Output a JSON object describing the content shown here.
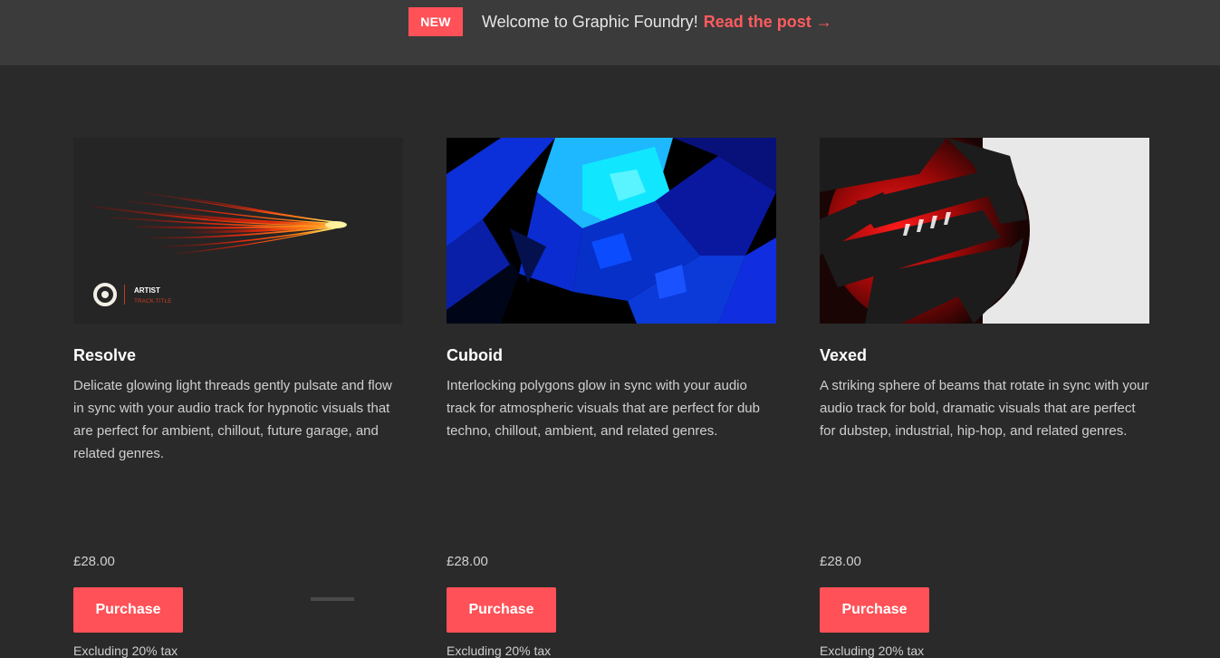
{
  "banner": {
    "badge": "NEW",
    "text": "Welcome to Graphic Foundry!",
    "link": "Read the post →"
  },
  "colors": {
    "accent": "#ff5157",
    "banner_bg": "#3b3b3b",
    "page_bg": "#2a2a2a"
  },
  "products": [
    {
      "title": "Resolve",
      "description": "Delicate glowing light threads gently pulsate and flow in sync with your audio track for hypnotic visuals that are perfect for ambient, chillout, future garage, and related genres.",
      "price": "£28.00",
      "button": "Purchase",
      "tax": "Excluding 20% tax",
      "thumb_artist": "ARTIST",
      "thumb_track": "TRACK TITLE"
    },
    {
      "title": "Cuboid",
      "description": "Interlocking polygons glow in sync with your audio track for atmospheric visuals that are perfect for dub techno, chillout, ambient, and related genres.",
      "price": "£28.00",
      "button": "Purchase",
      "tax": "Excluding 20% tax"
    },
    {
      "title": "Vexed",
      "description": "A striking sphere of beams that rotate in sync with your audio track for bold, dramatic visuals that are perfect for dubstep, industrial, hip-hop, and related genres.",
      "price": "£28.00",
      "button": "Purchase",
      "tax": "Excluding 20% tax"
    }
  ]
}
